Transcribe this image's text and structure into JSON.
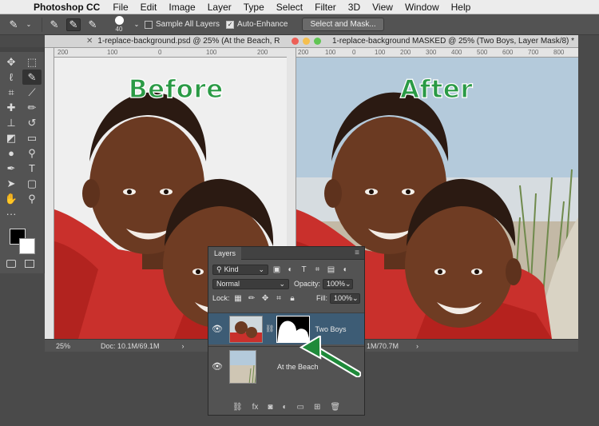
{
  "menubar": {
    "apple_icon": "apple-icon",
    "app_name": "Photoshop CC",
    "items": [
      "File",
      "Edit",
      "Image",
      "Layer",
      "Type",
      "Select",
      "Filter",
      "3D",
      "View",
      "Window",
      "Help"
    ]
  },
  "options": {
    "brush_size": "40",
    "sample_all_layers": "Sample All Layers",
    "auto_enhance": "Auto-Enhance",
    "select_mask_button": "Select and Mask..."
  },
  "doc1": {
    "title": "1-replace-background.psd @ 25% (At the Beach, R",
    "heading": "Before",
    "zoom": "25%",
    "doc_size": "Doc: 10.1M/69.1M",
    "ruler_marks": [
      "200",
      "100",
      "0",
      "100",
      "200"
    ]
  },
  "doc2": {
    "title": "1-replace-background MASKED @ 25% (Two Boys, Layer Mask/8) *",
    "heading": "After",
    "doc_size": "1M/70.7M",
    "ruler_marks": [
      "200",
      "100",
      "0",
      "100",
      "200",
      "300",
      "400",
      "500",
      "600",
      "700",
      "800"
    ]
  },
  "layers": {
    "tab": "Layers",
    "kind": "Kind",
    "blend_mode": "Normal",
    "opacity_label": "Opacity:",
    "opacity_value": "100%",
    "lock_label": "Lock:",
    "fill_label": "Fill:",
    "fill_value": "100%",
    "items": [
      {
        "name": "Two Boys",
        "selected": true
      },
      {
        "name": "At the Beach",
        "selected": false
      }
    ]
  },
  "colors": {
    "heading_green": "#2a9a45",
    "arrow_green": "#1f8a3a",
    "selected_layer": "#3d5c75",
    "shirt_red": "#c9302c",
    "skin": "#6b3a22"
  }
}
